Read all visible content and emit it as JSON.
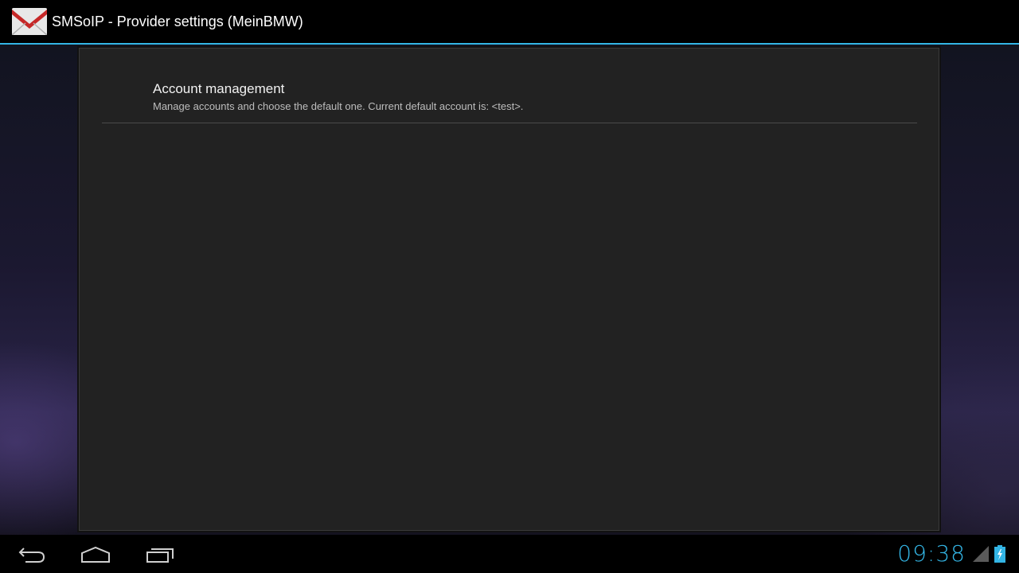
{
  "action_bar": {
    "title": "SMSoIP - Provider settings (MeinBMW)",
    "icon": "envelope-app-icon"
  },
  "preferences": [
    {
      "title": "Account management",
      "summary": "Manage accounts and choose the default one. Current default account is: <test>."
    }
  ],
  "navigation": {
    "back_icon": "back-icon",
    "home_icon": "home-icon",
    "recents_icon": "recent-apps-icon"
  },
  "status": {
    "time": "09:38",
    "signal_icon": "signal-icon",
    "battery_icon": "battery-charging-icon"
  },
  "colors": {
    "accent": "#33b5e5",
    "panel": "#222222",
    "background": "#000000"
  }
}
